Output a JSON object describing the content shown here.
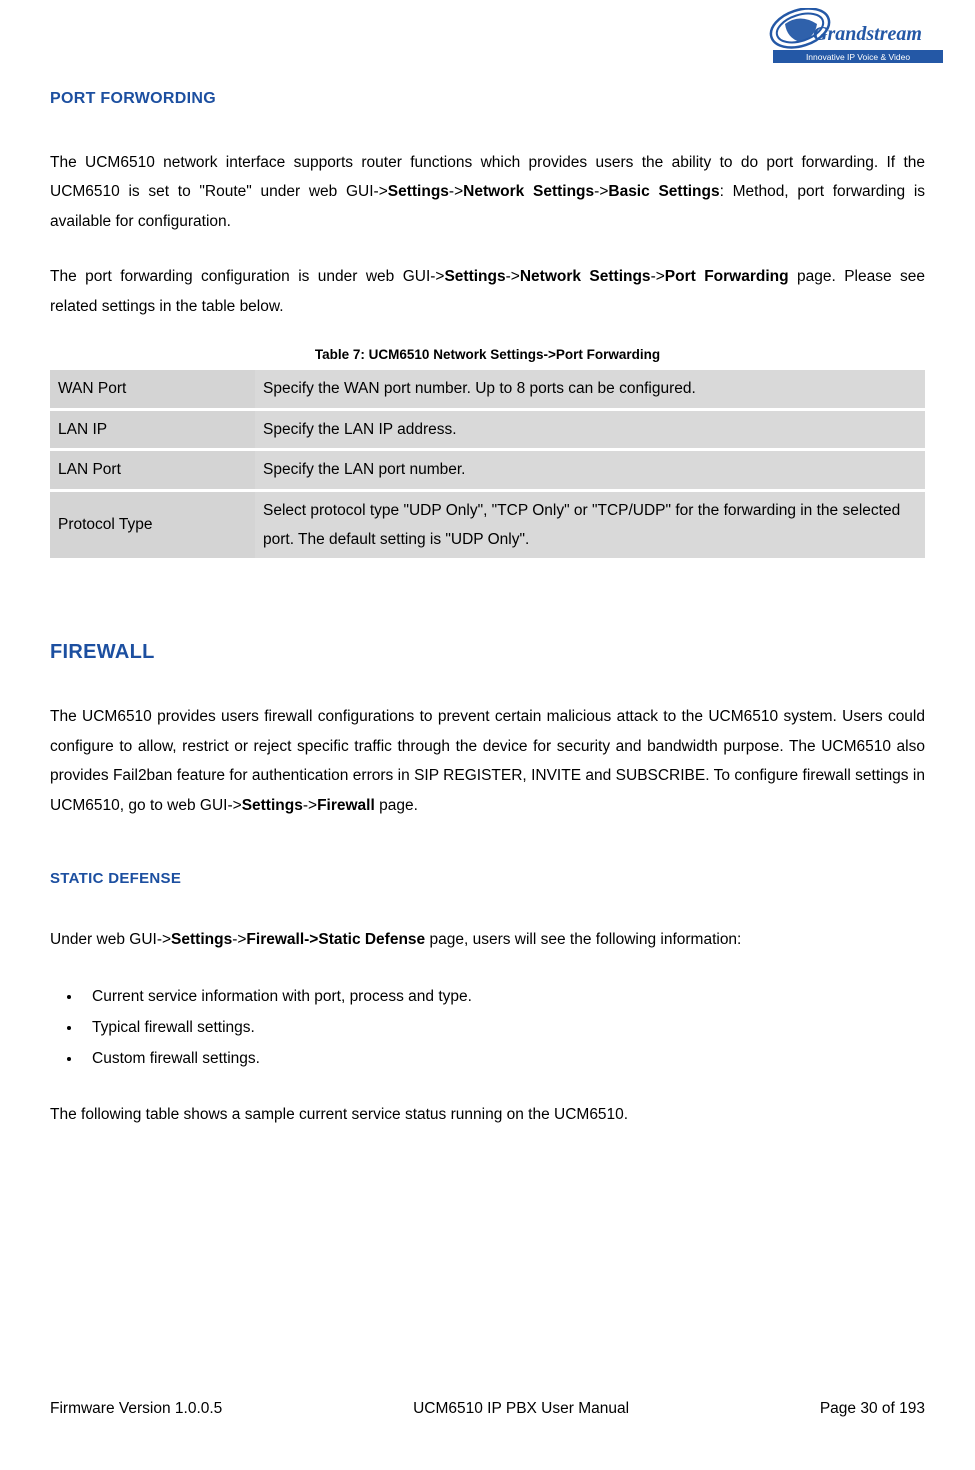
{
  "logo": {
    "brand": "Grandstream",
    "tagline": "Innovative IP Voice & Video"
  },
  "sections": {
    "port_forwording": {
      "title": "PORT FORWORDING",
      "p1_a": "The UCM6510 network interface supports router functions which provides users the ability to do port forwarding. If the UCM6510 is set to \"Route\" under web GUI->",
      "p1_b": "Settings",
      "p1_c": "->",
      "p1_d": "Network Settings",
      "p1_e": "->",
      "p1_f": "Basic Settings",
      "p1_g": ": Method, port forwarding is available for configuration.",
      "p2_a": "The port forwarding configuration is under web GUI->",
      "p2_b": "Settings",
      "p2_c": "->",
      "p2_d": "Network Settings",
      "p2_e": "->",
      "p2_f": "Port Forwarding",
      "p2_g": " page. Please see related settings in the table below."
    },
    "table7": {
      "caption": "Table 7: UCM6510 Network Settings->Port Forwarding",
      "rows": [
        {
          "label": "WAN Port",
          "desc": "Specify the WAN port number. Up to 8 ports can be configured."
        },
        {
          "label": "LAN IP",
          "desc": "Specify the LAN IP address."
        },
        {
          "label": "LAN Port",
          "desc": "Specify the LAN port number."
        },
        {
          "label": "Protocol Type",
          "desc": "Select protocol type \"UDP Only\", \"TCP Only\" or \"TCP/UDP\" for the forwarding in the selected port. The default setting is \"UDP Only\"."
        }
      ]
    },
    "firewall": {
      "title": "FIREWALL",
      "p1_a": "The UCM6510 provides users firewall configurations to prevent certain malicious attack to the UCM6510 system. Users could configure to allow, restrict or reject specific traffic through the device for security and bandwidth purpose. The UCM6510 also provides Fail2ban feature for authentication errors in SIP REGISTER, INVITE and SUBSCRIBE. To configure firewall settings in UCM6510, go to web GUI->",
      "p1_b": "Settings",
      "p1_c": "->",
      "p1_d": "Firewall",
      "p1_e": " page."
    },
    "static_defense": {
      "title": "STATIC DEFENSE",
      "p1_a": "Under web GUI->",
      "p1_b": "Settings",
      "p1_c": "->",
      "p1_d": "Firewall->Static Defense",
      "p1_e": " page, users will see the following information:",
      "bullets": [
        "Current service information with port, process and type.",
        "Typical firewall settings.",
        "Custom firewall settings."
      ],
      "p2": "The following table shows a sample current service status running on the UCM6510."
    }
  },
  "footer": {
    "left": "Firmware Version 1.0.0.5",
    "center": "UCM6510 IP PBX User Manual",
    "right": "Page 30 of 193"
  }
}
